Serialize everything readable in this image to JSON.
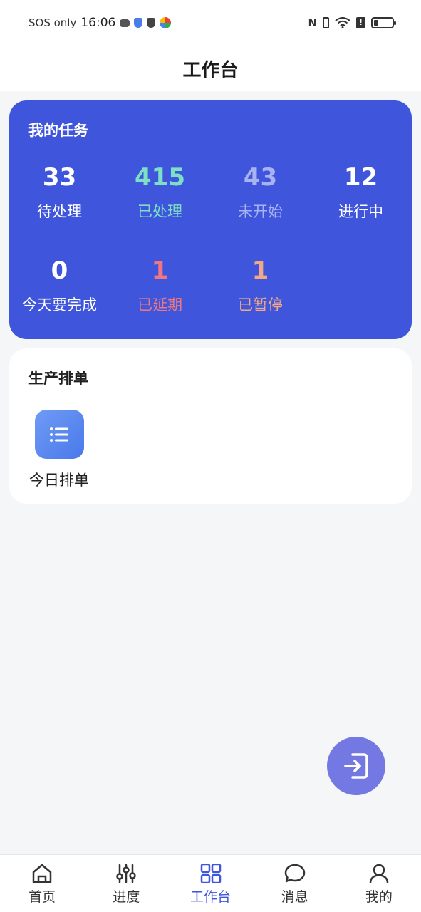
{
  "status_bar": {
    "carrier": "SOS only",
    "time": "16:06"
  },
  "header": {
    "title": "工作台"
  },
  "tasks": {
    "title": "我的任务",
    "stats": [
      {
        "value": "33",
        "label": "待处理",
        "color": "#ffffff"
      },
      {
        "value": "415",
        "label": "已处理",
        "color": "#7de0c4"
      },
      {
        "value": "43",
        "label": "未开始",
        "color": "#a9b3f2"
      },
      {
        "value": "12",
        "label": "进行中",
        "color": "#ffffff"
      },
      {
        "value": "0",
        "label": "今天要完成",
        "color": "#ffffff"
      },
      {
        "value": "1",
        "label": "已延期",
        "color": "#f0777f"
      },
      {
        "value": "1",
        "label": "已暂停",
        "color": "#f2a882"
      }
    ]
  },
  "production": {
    "title": "生产排单",
    "items": [
      {
        "label": "今日排单",
        "icon": "list-icon"
      }
    ]
  },
  "fab": {
    "icon": "exit-icon"
  },
  "tabbar": {
    "tabs": [
      {
        "label": "首页",
        "icon": "home-icon"
      },
      {
        "label": "进度",
        "icon": "sliders-icon"
      },
      {
        "label": "工作台",
        "icon": "grid-icon",
        "active": true
      },
      {
        "label": "消息",
        "icon": "chat-icon"
      },
      {
        "label": "我的",
        "icon": "user-icon"
      }
    ]
  },
  "colors": {
    "accent": "#3f56dc",
    "fab": "#7378e2",
    "background": "#f5f6f8"
  }
}
